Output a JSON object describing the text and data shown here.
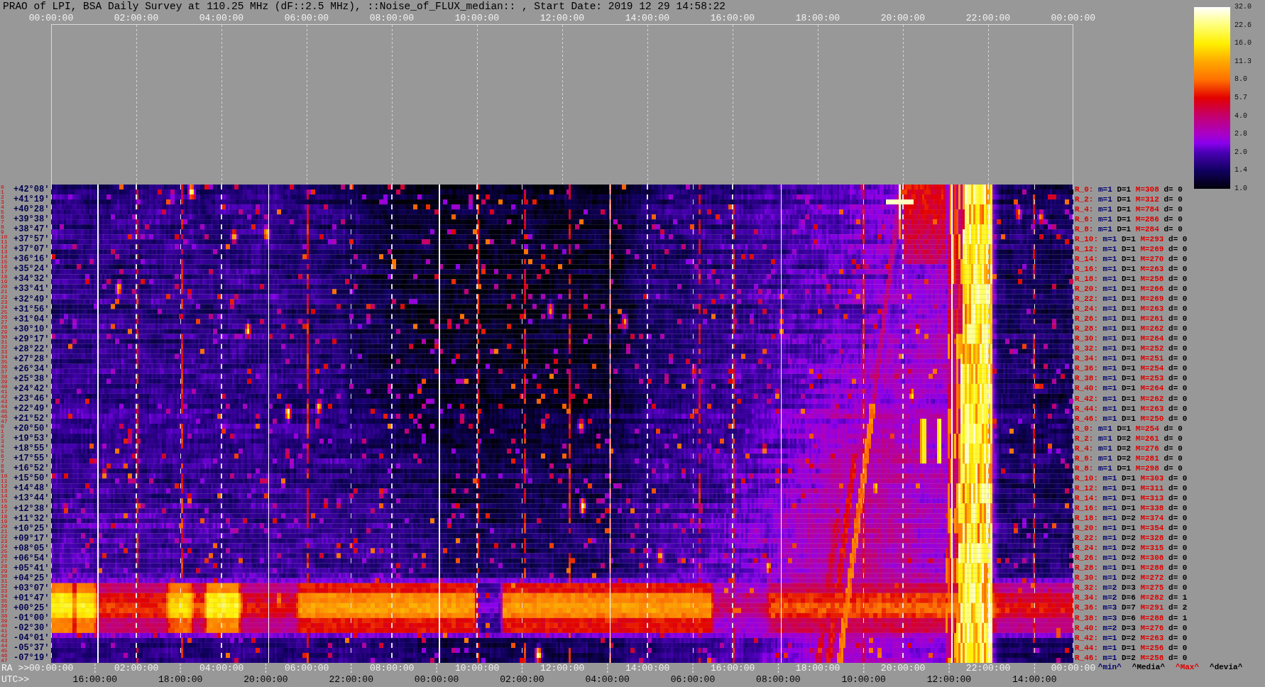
{
  "title": "PRAO of LPI, BSA Daily Survey at 110.25 MHz (dF::2.5 MHz), ::Noise_of_FLUX_median:: , Start Date: 2019 12 29 14:58:22",
  "top_time_axis": {
    "labels": [
      "00:00:00",
      "02:00:00",
      "04:00:00",
      "06:00:00",
      "08:00:00",
      "10:00:00",
      "12:00:00",
      "14:00:00",
      "16:00:00",
      "18:00:00",
      "20:00:00",
      "22:00:00",
      "00:00:00"
    ]
  },
  "color_scale": {
    "tick_labels": [
      "32.0",
      "22.6",
      "16.0",
      "11.3",
      "8.0",
      "5.7",
      "4.0",
      "2.8",
      "2.0",
      "1.4",
      "1.0"
    ]
  },
  "declination_rows": [
    {
      "beam_numbers": [
        "0",
        "1"
      ],
      "declination": "+42°08'"
    },
    {
      "beam_numbers": [
        "2",
        "3"
      ],
      "declination": "+41°19'"
    },
    {
      "beam_numbers": [
        "4",
        "5"
      ],
      "declination": "+40°28'"
    },
    {
      "beam_numbers": [
        "6",
        "7"
      ],
      "declination": "+39°38'"
    },
    {
      "beam_numbers": [
        "8",
        "9"
      ],
      "declination": "+38°47'"
    },
    {
      "beam_numbers": [
        "10",
        "11"
      ],
      "declination": "+37°57'"
    },
    {
      "beam_numbers": [
        "12",
        "13"
      ],
      "declination": "+37°07'"
    },
    {
      "beam_numbers": [
        "14",
        "15"
      ],
      "declination": "+36°16'"
    },
    {
      "beam_numbers": [
        "16",
        "17"
      ],
      "declination": "+35°24'"
    },
    {
      "beam_numbers": [
        "18",
        "19"
      ],
      "declination": "+34°32'"
    },
    {
      "beam_numbers": [
        "20",
        "21"
      ],
      "declination": "+33°41'"
    },
    {
      "beam_numbers": [
        "22",
        "23"
      ],
      "declination": "+32°49'"
    },
    {
      "beam_numbers": [
        "24",
        "25"
      ],
      "declination": "+31°56'"
    },
    {
      "beam_numbers": [
        "26",
        "27"
      ],
      "declination": "+31°04'"
    },
    {
      "beam_numbers": [
        "28",
        "29"
      ],
      "declination": "+30°10'"
    },
    {
      "beam_numbers": [
        "30",
        "31"
      ],
      "declination": "+29°17'"
    },
    {
      "beam_numbers": [
        "32",
        "33"
      ],
      "declination": "+28°22'"
    },
    {
      "beam_numbers": [
        "34",
        "35"
      ],
      "declination": "+27°28'"
    },
    {
      "beam_numbers": [
        "36",
        "37"
      ],
      "declination": "+26°34'"
    },
    {
      "beam_numbers": [
        "38",
        "39"
      ],
      "declination": "+25°38'"
    },
    {
      "beam_numbers": [
        "40",
        "41"
      ],
      "declination": "+24°42'"
    },
    {
      "beam_numbers": [
        "42",
        "43"
      ],
      "declination": "+23°46'"
    },
    {
      "beam_numbers": [
        "44",
        "45"
      ],
      "declination": "+22°49'"
    },
    {
      "beam_numbers": [
        "46",
        "47"
      ],
      "declination": "+21°52'"
    },
    {
      "beam_numbers": [
        "0",
        "1"
      ],
      "declination": "+20°50'"
    },
    {
      "beam_numbers": [
        "2",
        "3"
      ],
      "declination": "+19°53'"
    },
    {
      "beam_numbers": [
        "4",
        "5"
      ],
      "declination": "+18°55'"
    },
    {
      "beam_numbers": [
        "6",
        "7"
      ],
      "declination": "+17°55'"
    },
    {
      "beam_numbers": [
        "8",
        "9"
      ],
      "declination": "+16°52'"
    },
    {
      "beam_numbers": [
        "10",
        "11"
      ],
      "declination": "+15°50'"
    },
    {
      "beam_numbers": [
        "12",
        "13"
      ],
      "declination": "+14°48'"
    },
    {
      "beam_numbers": [
        "14",
        "15"
      ],
      "declination": "+13°44'"
    },
    {
      "beam_numbers": [
        "16",
        "17"
      ],
      "declination": "+12°38'"
    },
    {
      "beam_numbers": [
        "18",
        "19"
      ],
      "declination": "+11°32'"
    },
    {
      "beam_numbers": [
        "20",
        "21"
      ],
      "declination": "+10°25'"
    },
    {
      "beam_numbers": [
        "22",
        "23"
      ],
      "declination": "+09°17'"
    },
    {
      "beam_numbers": [
        "24",
        "25"
      ],
      "declination": "+08°05'"
    },
    {
      "beam_numbers": [
        "26",
        "27"
      ],
      "declination": "+06°54'"
    },
    {
      "beam_numbers": [
        "28",
        "29"
      ],
      "declination": "+05°41'"
    },
    {
      "beam_numbers": [
        "30",
        "31"
      ],
      "declination": "+04°25'"
    },
    {
      "beam_numbers": [
        "32",
        "33"
      ],
      "declination": "+03°07'"
    },
    {
      "beam_numbers": [
        "34",
        "35"
      ],
      "declination": "+01°47'"
    },
    {
      "beam_numbers": [
        "36",
        "37"
      ],
      "declination": "+00°25'"
    },
    {
      "beam_numbers": [
        "38",
        "39"
      ],
      "declination": "-01°00'"
    },
    {
      "beam_numbers": [
        "40",
        "41"
      ],
      "declination": "-02°30'"
    },
    {
      "beam_numbers": [
        "42",
        "43"
      ],
      "declination": "-04°01'"
    },
    {
      "beam_numbers": [
        "44",
        "45"
      ],
      "declination": "-05°37'"
    },
    {
      "beam_numbers": [
        "46",
        "47"
      ],
      "declination": "-07°19'"
    }
  ],
  "beam_stats": [
    {
      "beam": "R_0:",
      "min": "m=1",
      "median": "D=1",
      "max": "M=308",
      "deviation": "d= 0"
    },
    {
      "beam": "R_2:",
      "min": "m=1",
      "median": "D=1",
      "max": "M=312",
      "deviation": "d= 0"
    },
    {
      "beam": "R_4:",
      "min": "m=1",
      "median": "D=1",
      "max": "M=784",
      "deviation": "d= 0"
    },
    {
      "beam": "R_6:",
      "min": "m=1",
      "median": "D=1",
      "max": "M=286",
      "deviation": "d= 0"
    },
    {
      "beam": "R_8:",
      "min": "m=1",
      "median": "D=1",
      "max": "M=284",
      "deviation": "d= 0"
    },
    {
      "beam": "R_10:",
      "min": "m=1",
      "median": "D=1",
      "max": "M=293",
      "deviation": "d= 0"
    },
    {
      "beam": "R_12:",
      "min": "m=1",
      "median": "D=1",
      "max": "M=269",
      "deviation": "d= 0"
    },
    {
      "beam": "R_14:",
      "min": "m=1",
      "median": "D=1",
      "max": "M=270",
      "deviation": "d= 0"
    },
    {
      "beam": "R_16:",
      "min": "m=1",
      "median": "D=1",
      "max": "M=263",
      "deviation": "d= 0"
    },
    {
      "beam": "R_18:",
      "min": "m=1",
      "median": "D=1",
      "max": "M=258",
      "deviation": "d= 0"
    },
    {
      "beam": "R_20:",
      "min": "m=1",
      "median": "D=1",
      "max": "M=266",
      "deviation": "d= 0"
    },
    {
      "beam": "R_22:",
      "min": "m=1",
      "median": "D=1",
      "max": "M=269",
      "deviation": "d= 0"
    },
    {
      "beam": "R_24:",
      "min": "m=1",
      "median": "D=1",
      "max": "M=263",
      "deviation": "d= 0"
    },
    {
      "beam": "R_26:",
      "min": "m=1",
      "median": "D=1",
      "max": "M=261",
      "deviation": "d= 0"
    },
    {
      "beam": "R_28:",
      "min": "m=1",
      "median": "D=1",
      "max": "M=262",
      "deviation": "d= 0"
    },
    {
      "beam": "R_30:",
      "min": "m=1",
      "median": "D=1",
      "max": "M=264",
      "deviation": "d= 0"
    },
    {
      "beam": "R_32:",
      "min": "m=1",
      "median": "D=1",
      "max": "M=252",
      "deviation": "d= 0"
    },
    {
      "beam": "R_34:",
      "min": "m=1",
      "median": "D=1",
      "max": "M=251",
      "deviation": "d= 0"
    },
    {
      "beam": "R_36:",
      "min": "m=1",
      "median": "D=1",
      "max": "M=254",
      "deviation": "d= 0"
    },
    {
      "beam": "R_38:",
      "min": "m=1",
      "median": "D=1",
      "max": "M=253",
      "deviation": "d= 0"
    },
    {
      "beam": "R_40:",
      "min": "m=1",
      "median": "D=1",
      "max": "M=264",
      "deviation": "d= 0"
    },
    {
      "beam": "R_42:",
      "min": "m=1",
      "median": "D=1",
      "max": "M=262",
      "deviation": "d= 0"
    },
    {
      "beam": "R_44:",
      "min": "m=1",
      "median": "D=1",
      "max": "M=263",
      "deviation": "d= 0"
    },
    {
      "beam": "R_46:",
      "min": "m=1",
      "median": "D=1",
      "max": "M=250",
      "deviation": "d= 0"
    },
    {
      "beam": "R_0:",
      "min": "m=1",
      "median": "D=1",
      "max": "M=254",
      "deviation": "d= 0"
    },
    {
      "beam": "R_2:",
      "min": "m=1",
      "median": "D=2",
      "max": "M=261",
      "deviation": "d= 0"
    },
    {
      "beam": "R_4:",
      "min": "m=1",
      "median": "D=2",
      "max": "M=276",
      "deviation": "d= 0"
    },
    {
      "beam": "R_6:",
      "min": "m=1",
      "median": "D=2",
      "max": "M=281",
      "deviation": "d= 0"
    },
    {
      "beam": "R_8:",
      "min": "m=1",
      "median": "D=1",
      "max": "M=298",
      "deviation": "d= 0"
    },
    {
      "beam": "R_10:",
      "min": "m=1",
      "median": "D=1",
      "max": "M=303",
      "deviation": "d= 0"
    },
    {
      "beam": "R_12:",
      "min": "m=1",
      "median": "D=1",
      "max": "M=311",
      "deviation": "d= 0"
    },
    {
      "beam": "R_14:",
      "min": "m=1",
      "median": "D=1",
      "max": "M=313",
      "deviation": "d= 0"
    },
    {
      "beam": "R_16:",
      "min": "m=1",
      "median": "D=1",
      "max": "M=338",
      "deviation": "d= 0"
    },
    {
      "beam": "R_18:",
      "min": "m=1",
      "median": "D=2",
      "max": "M=374",
      "deviation": "d= 0"
    },
    {
      "beam": "R_20:",
      "min": "m=1",
      "median": "D=1",
      "max": "M=354",
      "deviation": "d= 0"
    },
    {
      "beam": "R_22:",
      "min": "m=1",
      "median": "D=2",
      "max": "M=328",
      "deviation": "d= 0"
    },
    {
      "beam": "R_24:",
      "min": "m=1",
      "median": "D=2",
      "max": "M=315",
      "deviation": "d= 0"
    },
    {
      "beam": "R_26:",
      "min": "m=1",
      "median": "D=2",
      "max": "M=308",
      "deviation": "d= 0"
    },
    {
      "beam": "R_28:",
      "min": "m=1",
      "median": "D=1",
      "max": "M=288",
      "deviation": "d= 0"
    },
    {
      "beam": "R_30:",
      "min": "m=1",
      "median": "D=2",
      "max": "M=272",
      "deviation": "d= 0"
    },
    {
      "beam": "R_32:",
      "min": "m=2",
      "median": "D=3",
      "max": "M=275",
      "deviation": "d= 0"
    },
    {
      "beam": "R_34:",
      "min": "m=2",
      "median": "D=6",
      "max": "M=282",
      "deviation": "d= 1"
    },
    {
      "beam": "R_36:",
      "min": "m=3",
      "median": "D=7",
      "max": "M=291",
      "deviation": "d= 2"
    },
    {
      "beam": "R_38:",
      "min": "m=3",
      "median": "D=6",
      "max": "M=288",
      "deviation": "d= 1"
    },
    {
      "beam": "R_40:",
      "min": "m=2",
      "median": "D=3",
      "max": "M=276",
      "deviation": "d= 0"
    },
    {
      "beam": "R_42:",
      "min": "m=1",
      "median": "D=2",
      "max": "M=263",
      "deviation": "d= 0"
    },
    {
      "beam": "R_44:",
      "min": "m=1",
      "median": "D=1",
      "max": "M=256",
      "deviation": "d= 0"
    },
    {
      "beam": "R_46:",
      "min": "m=1",
      "median": "D=2",
      "max": "M=258",
      "deviation": "d= 0"
    }
  ],
  "ra_axis": {
    "title": "RA >>",
    "labels": [
      "00:00:00",
      "02:00:00",
      "04:00:00",
      "06:00:00",
      "08:00:00",
      "10:00:00",
      "12:00:00",
      "14:00:00",
      "16:00:00",
      "18:00:00",
      "20:00:00",
      "22:00:00",
      "00:00:00"
    ]
  },
  "stats_legend": [
    {
      "kind": "min",
      "label": "^min^"
    },
    {
      "kind": "median",
      "label": "^Media^"
    },
    {
      "kind": "max",
      "label": "^Max^"
    },
    {
      "kind": "deviation",
      "label": "^devia^"
    }
  ],
  "utc_axis": {
    "title": "UTC>>",
    "labels": [
      "16:00:00",
      "18:00:00",
      "20:00:00",
      "22:00:00",
      "00:00:00",
      "02:00:00",
      "04:00:00",
      "06:00:00",
      "08:00:00",
      "10:00:00",
      "12:00:00",
      "14:00:00"
    ]
  }
}
